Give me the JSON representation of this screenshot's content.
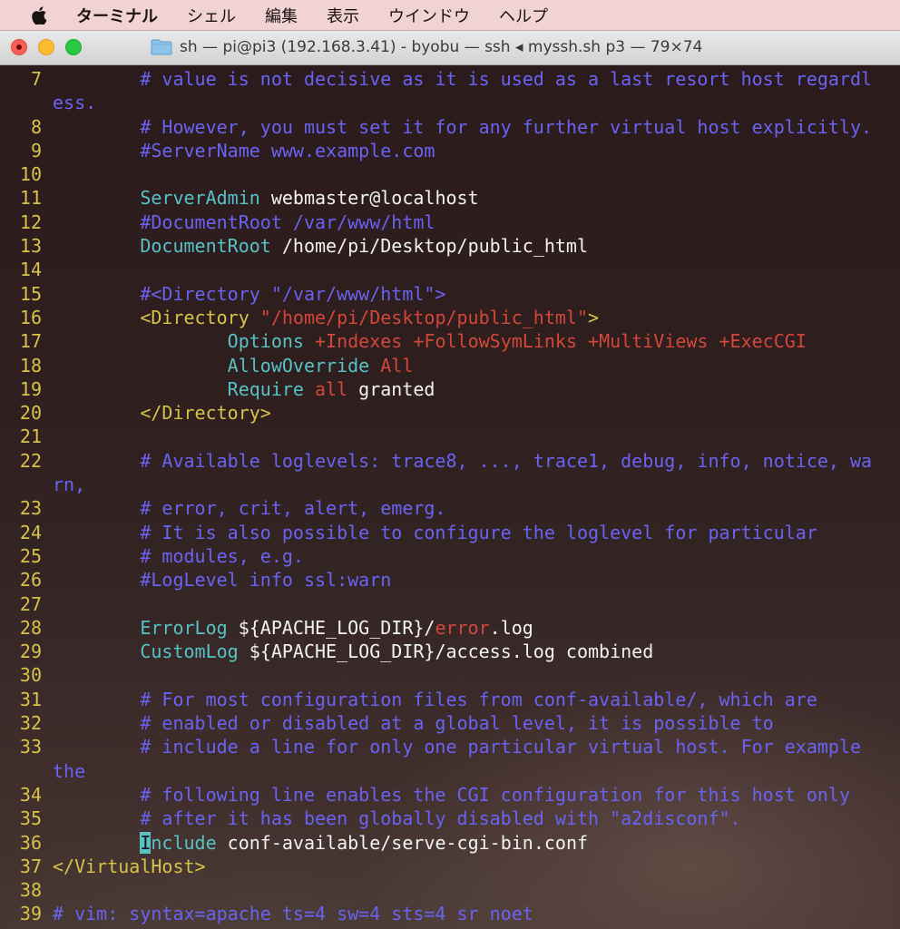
{
  "menubar": {
    "apple_icon": "apple-logo-icon",
    "items": [
      "ターミナル",
      "シェル",
      "編集",
      "表示",
      "ウインドウ",
      "ヘルプ"
    ]
  },
  "window": {
    "title": "sh — pi@pi3 (192.168.3.41) - byobu — ssh ◂ myssh.sh p3 — 79×74",
    "folder_icon": "folder-icon"
  },
  "terminal": {
    "colors": {
      "line_number": "#d7c24a",
      "comment": "#6a63f2",
      "directive": "#56c2c7",
      "flag": "#d3473a",
      "tag": "#d7c24a",
      "text": "#f2f2f2",
      "cursor": "#56c2c7"
    },
    "lines": [
      {
        "num": "7",
        "indent": 8,
        "segs": [
          [
            "cm",
            "# value is not decisive as it is used as a last resort host regardl"
          ]
        ]
      },
      {
        "num": "",
        "indent": 0,
        "segs": [
          [
            "cm",
            "ess."
          ]
        ]
      },
      {
        "num": "8",
        "indent": 8,
        "segs": [
          [
            "cm",
            "# However, you must set it for any further virtual host explicitly."
          ]
        ]
      },
      {
        "num": "9",
        "indent": 8,
        "segs": [
          [
            "cm",
            "#ServerName www.example.com"
          ]
        ]
      },
      {
        "num": "10",
        "indent": 0,
        "segs": []
      },
      {
        "num": "11",
        "indent": 8,
        "segs": [
          [
            "dr",
            "ServerAdmin"
          ],
          [
            "tx",
            " webmaster@localhost"
          ]
        ]
      },
      {
        "num": "12",
        "indent": 8,
        "segs": [
          [
            "cm",
            "#DocumentRoot /var/www/html"
          ]
        ]
      },
      {
        "num": "13",
        "indent": 8,
        "segs": [
          [
            "dr",
            "DocumentRoot"
          ],
          [
            "tx",
            " /home/pi/Desktop/public_html"
          ]
        ]
      },
      {
        "num": "14",
        "indent": 0,
        "segs": []
      },
      {
        "num": "15",
        "indent": 8,
        "segs": [
          [
            "cm",
            "#<Directory \"/var/www/html\">"
          ]
        ]
      },
      {
        "num": "16",
        "indent": 8,
        "segs": [
          [
            "tg",
            "<Directory "
          ],
          [
            "st",
            "\"/home/pi/Desktop/public_html\""
          ],
          [
            "tg",
            ">"
          ]
        ]
      },
      {
        "num": "17",
        "indent": 16,
        "segs": [
          [
            "dr",
            "Options"
          ],
          [
            "tx",
            " "
          ],
          [
            "fl",
            "+Indexes +FollowSymLinks +MultiViews +ExecCGI"
          ]
        ]
      },
      {
        "num": "18",
        "indent": 16,
        "segs": [
          [
            "dr",
            "AllowOverride"
          ],
          [
            "tx",
            " "
          ],
          [
            "fl",
            "All"
          ]
        ]
      },
      {
        "num": "19",
        "indent": 16,
        "segs": [
          [
            "dr",
            "Require"
          ],
          [
            "tx",
            " "
          ],
          [
            "fl",
            "all"
          ],
          [
            "tx",
            " granted"
          ]
        ]
      },
      {
        "num": "20",
        "indent": 8,
        "segs": [
          [
            "tg",
            "</Directory>"
          ]
        ]
      },
      {
        "num": "21",
        "indent": 0,
        "segs": []
      },
      {
        "num": "22",
        "indent": 8,
        "segs": [
          [
            "cm",
            "# Available loglevels: trace8, ..., trace1, debug, info, notice, wa"
          ]
        ]
      },
      {
        "num": "",
        "indent": 0,
        "segs": [
          [
            "cm",
            "rn,"
          ]
        ]
      },
      {
        "num": "23",
        "indent": 8,
        "segs": [
          [
            "cm",
            "# error, crit, alert, emerg."
          ]
        ]
      },
      {
        "num": "24",
        "indent": 8,
        "segs": [
          [
            "cm",
            "# It is also possible to configure the loglevel for particular"
          ]
        ]
      },
      {
        "num": "25",
        "indent": 8,
        "segs": [
          [
            "cm",
            "# modules, e.g."
          ]
        ]
      },
      {
        "num": "26",
        "indent": 8,
        "segs": [
          [
            "cm",
            "#LogLevel info ssl:warn"
          ]
        ]
      },
      {
        "num": "27",
        "indent": 0,
        "segs": []
      },
      {
        "num": "28",
        "indent": 8,
        "segs": [
          [
            "dr",
            "ErrorLog"
          ],
          [
            "tx",
            " ${APACHE_LOG_DIR}/"
          ],
          [
            "fl",
            "error"
          ],
          [
            "tx",
            ".log"
          ]
        ]
      },
      {
        "num": "29",
        "indent": 8,
        "segs": [
          [
            "dr",
            "CustomLog"
          ],
          [
            "tx",
            " ${APACHE_LOG_DIR}/access.log combined"
          ]
        ]
      },
      {
        "num": "30",
        "indent": 0,
        "segs": []
      },
      {
        "num": "31",
        "indent": 8,
        "segs": [
          [
            "cm",
            "# For most configuration files from conf-available/, which are"
          ]
        ]
      },
      {
        "num": "32",
        "indent": 8,
        "segs": [
          [
            "cm",
            "# enabled or disabled at a global level, it is possible to"
          ]
        ]
      },
      {
        "num": "33",
        "indent": 8,
        "segs": [
          [
            "cm",
            "# include a line for only one particular virtual host. For example"
          ]
        ]
      },
      {
        "num": "",
        "indent": 0,
        "segs": [
          [
            "cm",
            "the"
          ]
        ]
      },
      {
        "num": "34",
        "indent": 8,
        "segs": [
          [
            "cm",
            "# following line enables the CGI configuration for this host only"
          ]
        ]
      },
      {
        "num": "35",
        "indent": 8,
        "segs": [
          [
            "cm",
            "# after it has been globally disabled with \"a2disconf\"."
          ]
        ]
      },
      {
        "num": "36",
        "indent": 8,
        "segs": [
          [
            "cur",
            "I"
          ],
          [
            "dr",
            "nclude"
          ],
          [
            "tx",
            " conf-available/serve-cgi-bin.conf"
          ]
        ]
      },
      {
        "num": "37",
        "indent": 0,
        "segs": [
          [
            "tg",
            "</VirtualHost>"
          ]
        ]
      },
      {
        "num": "38",
        "indent": 0,
        "segs": []
      },
      {
        "num": "39",
        "indent": 0,
        "segs": [
          [
            "cm",
            "# vim: syntax=apache ts=4 sw=4 sts=4 sr noet"
          ]
        ]
      }
    ]
  }
}
